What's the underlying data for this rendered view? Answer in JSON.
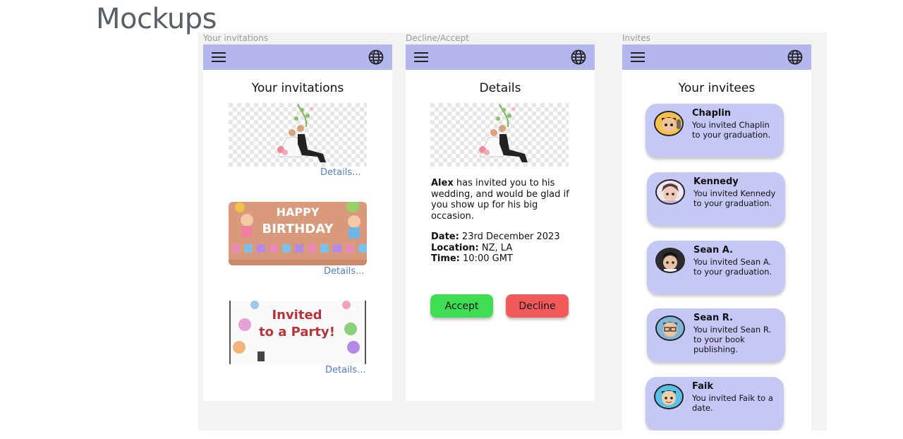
{
  "slide": {
    "title": "Mockups"
  },
  "frames": [
    {
      "label": "Your invitations"
    },
    {
      "label": "Decline/Accept"
    },
    {
      "label": "Invites"
    }
  ],
  "screen1": {
    "title": "Your invitations",
    "cards": [
      {
        "image": "wedding-couple-image",
        "details_label": "Details..."
      },
      {
        "image": "birthday-card-image",
        "banner": "HAPPY BIRTHDAY",
        "details_label": "Details..."
      },
      {
        "image": "party-card-image",
        "banner": "Invited to a Party!",
        "details_label": "Details..."
      }
    ]
  },
  "screen2": {
    "title": "Details",
    "host": "Alex",
    "message": " has invited you to his wedding, and would be glad if you show up for his big occasion.",
    "date_label": "Date:",
    "date_value": " 23rd December 2023",
    "location_label": "Location:",
    "location_value": " NZ, LA",
    "time_label": "Time:",
    "time_value": " 10:00 GMT",
    "accept_label": "Accept",
    "decline_label": "Decline"
  },
  "screen3": {
    "title": "Your invitees",
    "invitees": [
      {
        "name": "Chaplin",
        "desc": "You invited Chaplin to your graduation."
      },
      {
        "name": "Kennedy",
        "desc": "You invited Kennedy to your graduation."
      },
      {
        "name": "Sean A.",
        "desc": "You invited Sean A.  to your graduation."
      },
      {
        "name": "Sean R.",
        "desc": "You invited Sean R.  to your book publishing."
      },
      {
        "name": "Faik",
        "desc": "You invited Faik to a date."
      }
    ]
  },
  "icons": {
    "menu": "menu-icon",
    "language": "globe-icon"
  },
  "colors": {
    "appbar": "#b4b6ee",
    "card": "#c5c7f4",
    "accept": "#3fdd52",
    "decline": "#f25a5a",
    "link": "#4f7dc7"
  }
}
